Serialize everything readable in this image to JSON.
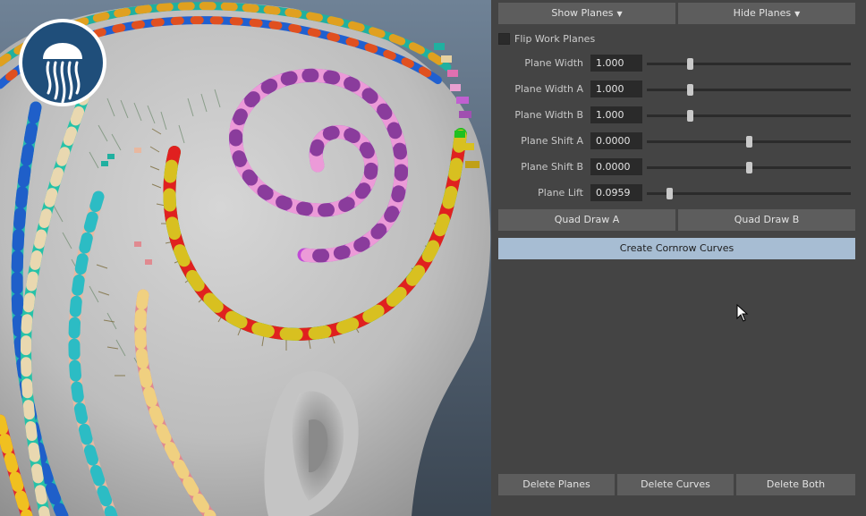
{
  "panel": {
    "show_planes": "Show Planes",
    "hide_planes": "Hide Planes",
    "flip_work_planes": "Flip Work Planes",
    "flip_checked": false,
    "rows": [
      {
        "label": "Plane Width",
        "value": "1.000",
        "slider_fraction": 0.21
      },
      {
        "label": "Plane Width A",
        "value": "1.000",
        "slider_fraction": 0.21
      },
      {
        "label": "Plane Width B",
        "value": "1.000",
        "slider_fraction": 0.21
      },
      {
        "label": "Plane Shift A",
        "value": "0.0000",
        "slider_fraction": 0.5
      },
      {
        "label": "Plane Shift B",
        "value": "0.0000",
        "slider_fraction": 0.5
      },
      {
        "label": "Plane Lift",
        "value": "0.0959",
        "slider_fraction": 0.11
      }
    ],
    "quad_draw_a": "Quad Draw A",
    "quad_draw_b": "Quad Draw B",
    "create_cornrow_curves": "Create Cornrow Curves",
    "delete_planes": "Delete Planes",
    "delete_curves": "Delete Curves",
    "delete_both": "Delete Both"
  },
  "viewport": {
    "logo_icon": "jellyfish-logo",
    "accent_colors": [
      "#c64fd8",
      "#e89cd4",
      "#e02020",
      "#20c020",
      "#d8c020",
      "#20b0a0",
      "#2060d0"
    ]
  }
}
